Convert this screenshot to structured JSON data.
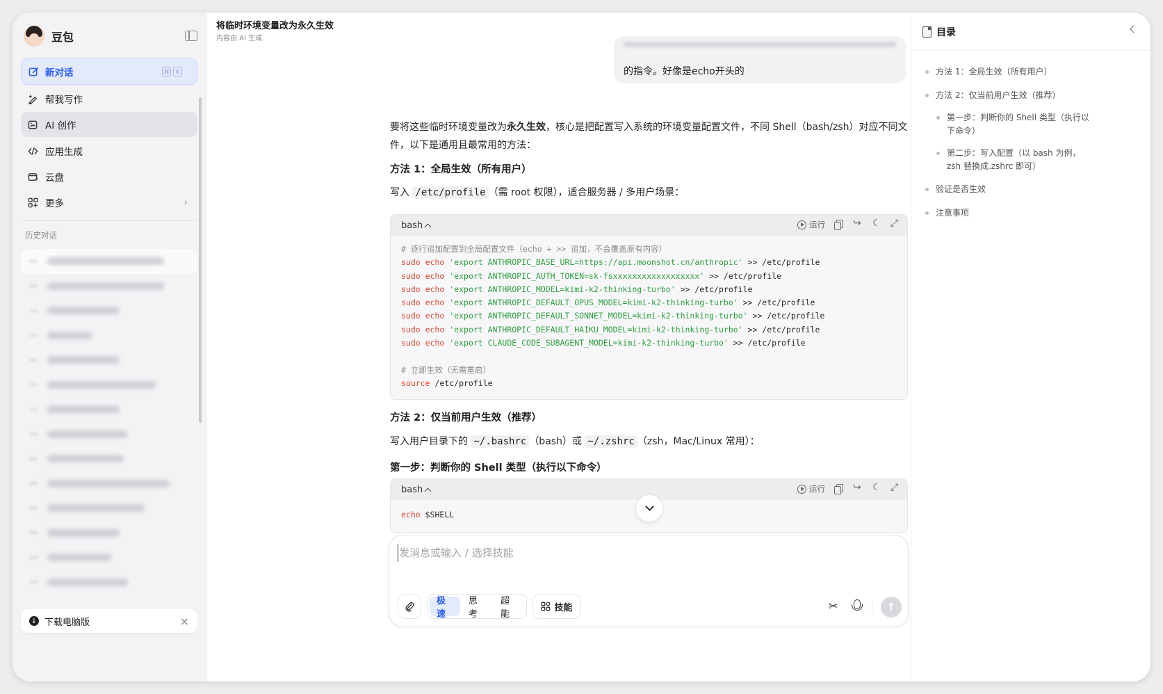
{
  "sidebar": {
    "app_name": "豆包",
    "new_chat": {
      "label": "新对话",
      "shortcut": [
        "⌘",
        "K"
      ]
    },
    "items": [
      {
        "label": "帮我写作",
        "icon": "pen-icon"
      },
      {
        "label": "AI 创作",
        "icon": "image-create-icon"
      },
      {
        "label": "应用生成",
        "icon": "code-icon"
      },
      {
        "label": "云盘",
        "icon": "cloud-drive-icon"
      },
      {
        "label": "更多",
        "icon": "grid-icon"
      }
    ],
    "history_title": "历史对话",
    "download": {
      "label": "下载电脑版"
    }
  },
  "main": {
    "title": "将临时环境变量改为永久生效",
    "subtitle": "内容由 AI 生成",
    "user_message_tail": "的指令。好像是echo开头的",
    "intro_pre": "要将这些临时环境变量改为",
    "intro_bold": "永久生效",
    "intro_post": "，核心是把配置写入系统的环境变量配置文件，不同 Shell（bash/zsh）对应不同文件，以下是通用且最常用的方法：",
    "method1_title": "方法 1：全局生效（所有用户）",
    "method1_pre": "写入",
    "method1_code": "/etc/profile",
    "method1_post": "（需 root 权限），适合服务器 / 多用户场景：",
    "code1": {
      "lang": "bash",
      "run_label": "运行",
      "comment1": "# 逐行追加配置到全局配置文件（echo + >> 追加，不会覆盖原有内容）",
      "lines": [
        {
          "cmd": "sudo echo",
          "str": "'export ANTHROPIC_BASE_URL=https://api.moonshot.cn/anthropic'",
          "rest": " >> /etc/profile"
        },
        {
          "cmd": "sudo echo",
          "str": "'export ANTHROPIC_AUTH_TOKEN=sk-fsxxxxxxxxxxxxxxxxxx'",
          "rest": " >> /etc/profile"
        },
        {
          "cmd": "sudo echo",
          "str": "'export ANTHROPIC_MODEL=kimi-k2-thinking-turbo'",
          "rest": " >> /etc/profile"
        },
        {
          "cmd": "sudo echo",
          "str": "'export ANTHROPIC_DEFAULT_OPUS_MODEL=kimi-k2-thinking-turbo'",
          "rest": " >> /etc/profile"
        },
        {
          "cmd": "sudo echo",
          "str": "'export ANTHROPIC_DEFAULT_SONNET_MODEL=kimi-k2-thinking-turbo'",
          "rest": " >> /etc/profile"
        },
        {
          "cmd": "sudo echo",
          "str": "'export ANTHROPIC_DEFAULT_HAIKU_MODEL=kimi-k2-thinking-turbo'",
          "rest": " >> /etc/profile"
        },
        {
          "cmd": "sudo echo",
          "str": "'export CLAUDE_CODE_SUBAGENT_MODEL=kimi-k2-thinking-turbo'",
          "rest": " >> /etc/profile"
        }
      ],
      "comment2": "# 立即生效（无需重启）",
      "source_kw": "source",
      "source_rest": " /etc/profile"
    },
    "method2_title": "方法 2：仅当前用户生效（推荐）",
    "method2_pre": "写入用户目录下的",
    "method2_code1": "~/.bashrc",
    "method2_mid": "（bash）或",
    "method2_code2": "~/.zshrc",
    "method2_post": "（zsh，Mac/Linux 常用）：",
    "step1_title": "第一步：判断你的 Shell 类型（执行以下命令）",
    "code2": {
      "lang": "bash",
      "run_label": "运行",
      "cmd": "echo",
      "rest": " $SHELL"
    }
  },
  "composer": {
    "placeholder": "发消息或输入 / 选择技能",
    "modes": [
      "极速",
      "思考",
      "超能"
    ],
    "active_mode": "极速",
    "skill_label": "技能"
  },
  "toc": {
    "title": "目录",
    "items": [
      {
        "label": "方法 1：全局生效（所有用户）",
        "level": 1
      },
      {
        "label": "方法 2：仅当前用户生效（推荐）",
        "level": 1
      },
      {
        "label": "第一步：判断你的 Shell 类型（执行以下命令）",
        "level": 2
      },
      {
        "label": "第二步：写入配置（以 bash 为例，zsh 替换成.zshrc 即可）",
        "level": 2
      },
      {
        "label": "验证是否生效",
        "level": 1
      },
      {
        "label": "注意事项",
        "level": 1
      }
    ]
  },
  "colors": {
    "accent": "#2c5cf0",
    "code_keyword": "#d9482f",
    "code_string": "#2e9e3f",
    "code_comment": "#8a8a8e"
  }
}
